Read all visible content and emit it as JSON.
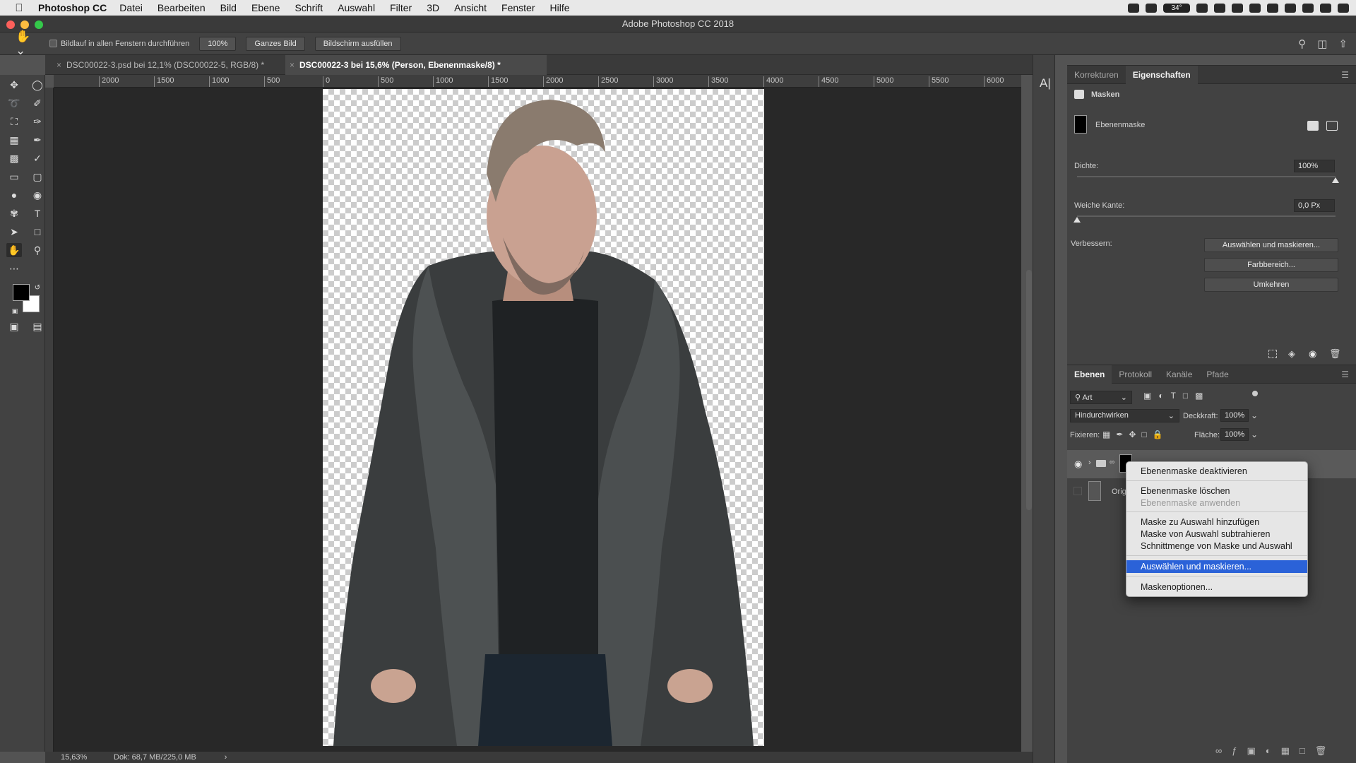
{
  "menubar": {
    "app_name": "Photoshop CC",
    "items": [
      "Datei",
      "Bearbeiten",
      "Bild",
      "Ebene",
      "Schrift",
      "Auswahl",
      "Filter",
      "3D",
      "Ansicht",
      "Fenster",
      "Hilfe"
    ],
    "status_badge": "34°"
  },
  "window": {
    "title": "Adobe Photoshop CC 2018"
  },
  "options": {
    "scroll_all_label": "Bildlauf in allen Fenstern durchführen",
    "zoom_button": "100%",
    "fit_screen_button": "Ganzes Bild",
    "fill_screen_button": "Bildschirm ausfüllen"
  },
  "tabs": [
    {
      "label": "DSC00022-3.psd bei 12,1% (DSC00022-5, RGB/8) *",
      "active": false
    },
    {
      "label": "DSC00022-3 bei 15,6% (Person, Ebenenmaske/8) *",
      "active": true
    }
  ],
  "ruler": {
    "top_ticks": [
      "2000",
      "1500",
      "1000",
      "500",
      "0",
      "500",
      "1000",
      "1500",
      "2000",
      "2500",
      "3000",
      "3500",
      "4000",
      "4500",
      "5000",
      "5500",
      "6000"
    ]
  },
  "status": {
    "zoom": "15,63%",
    "doc_info": "Dok: 68,7 MB/225,0 MB",
    "arrow": "›"
  },
  "properties": {
    "tabs": [
      "Korrekturen",
      "Eigenschaften"
    ],
    "active_tab": "Eigenschaften",
    "section_title": "Masken",
    "mask_type": "Ebenenmaske",
    "density_label": "Dichte:",
    "density_value": "100%",
    "density_level": 1.0,
    "feather_label": "Weiche Kante:",
    "feather_value": "0,0 Px",
    "feather_level": 0.0,
    "refine_label": "Verbessern:",
    "buttons": [
      "Auswählen und maskieren...",
      "Farbbereich...",
      "Umkehren"
    ]
  },
  "layers": {
    "tabs": [
      "Ebenen",
      "Protokoll",
      "Kanäle",
      "Pfade"
    ],
    "active_tab": "Ebenen",
    "filter_kind": "Art",
    "blend_mode": "Hindurchwirken",
    "opacity_label": "Deckkraft:",
    "opacity_value": "100%",
    "lock_label": "Fixieren:",
    "fill_label": "Fläche:",
    "fill_value": "100%",
    "rows": [
      {
        "name": "",
        "visible": true,
        "selected": true
      },
      {
        "name": "Orig",
        "visible": false,
        "selected": false
      }
    ]
  },
  "context_menu": {
    "items": [
      {
        "label": "Ebenenmaske deaktivieren",
        "disabled": false,
        "highlight": false
      },
      {
        "label": "Ebenenmaske löschen",
        "disabled": false,
        "highlight": false
      },
      {
        "label": "Ebenenmaske anwenden",
        "disabled": true,
        "highlight": false
      },
      {
        "label": "Maske zu Auswahl hinzufügen",
        "disabled": false,
        "highlight": false
      },
      {
        "label": "Maske von Auswahl subtrahieren",
        "disabled": false,
        "highlight": false
      },
      {
        "label": "Schnittmenge von Maske und Auswahl",
        "disabled": false,
        "highlight": false
      },
      {
        "label": "Auswählen und maskieren...",
        "disabled": false,
        "highlight": true
      },
      {
        "label": "Maskenoptionen...",
        "disabled": false,
        "highlight": false
      }
    ]
  },
  "colors": {
    "accent": "#2b62d8",
    "panel_bg": "#424242",
    "canvas_bg": "#282828",
    "foreground_swatch": "#000000",
    "background_swatch": "#ffffff"
  },
  "icons": {
    "tools": [
      "move-icon",
      "marquee-icon",
      "lasso-icon",
      "quick-select-icon",
      "crop-icon",
      "eyedropper-icon",
      "healing-icon",
      "brush-icon",
      "stamp-icon",
      "history-brush-icon",
      "eraser-icon",
      "gradient-icon",
      "blur-icon",
      "dodge-icon",
      "pen-icon",
      "type-icon",
      "path-select-icon",
      "shape-icon",
      "hand-icon",
      "zoom-icon",
      "more-icon"
    ]
  }
}
